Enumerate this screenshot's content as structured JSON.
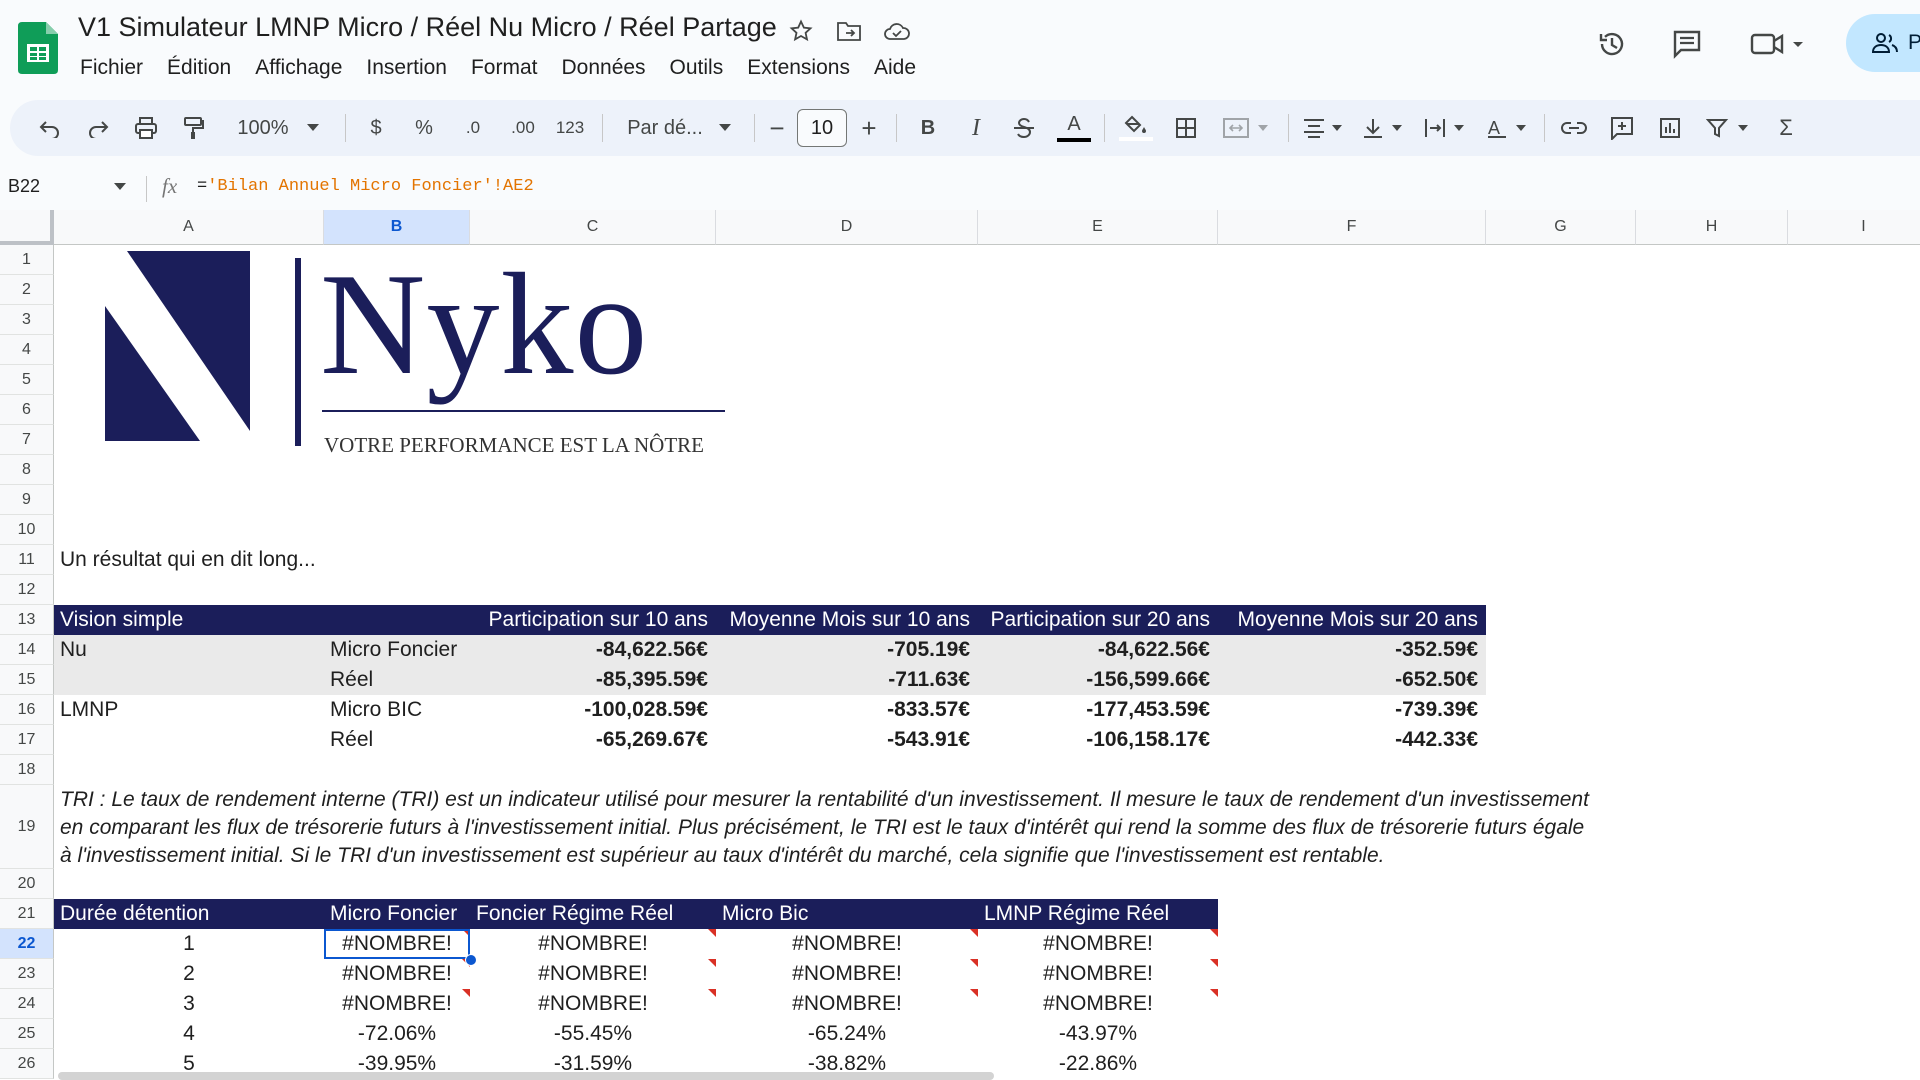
{
  "app": {
    "title": "V1 Simulateur LMNP Micro / Réel Nu Micro / Réel Partage",
    "share_label": "P"
  },
  "menu": [
    "Fichier",
    "Édition",
    "Affichage",
    "Insertion",
    "Format",
    "Données",
    "Outils",
    "Extensions",
    "Aide"
  ],
  "toolbar": {
    "zoom": "100%",
    "currency": "$",
    "percent": "%",
    "dec_decrease": ".0",
    "dec_increase": ".00",
    "number_format": "123",
    "font": "Par dé...",
    "font_size": "10",
    "minus": "−",
    "plus": "+",
    "bold": "B",
    "italic": "I",
    "text_color": "A",
    "sum": "Σ"
  },
  "formula_bar": {
    "cell_ref": "B22",
    "fx": "fx",
    "formula_prefix": "=",
    "formula_string": "'Bilan Annuel Micro Foncier'!AE2"
  },
  "columns": [
    "A",
    "B",
    "C",
    "D",
    "E",
    "F",
    "G",
    "H",
    "I"
  ],
  "rows": [
    "1",
    "2",
    "3",
    "4",
    "5",
    "6",
    "7",
    "8",
    "9",
    "10",
    "11",
    "12",
    "13",
    "14",
    "15",
    "16",
    "17",
    "18",
    "19",
    "20",
    "21",
    "22",
    "23",
    "24",
    "25",
    "26"
  ],
  "logo": {
    "brand": "Nyko",
    "tagline": "VOTRE PERFORMANCE EST LA NÔTRE"
  },
  "intro": "Un résultat qui en dit long...",
  "vision_table": {
    "headers": [
      "Vision simple",
      "Participation sur 10 ans",
      "Moyenne Mois sur 10 ans",
      "Participation sur 20 ans",
      "Moyenne Mois sur 20 ans"
    ],
    "rows": [
      {
        "group": "Nu",
        "regime": "Micro Foncier",
        "p10": "-84,622.56€",
        "m10": "-705.19€",
        "p20": "-84,622.56€",
        "m20": "-352.59€"
      },
      {
        "group": "",
        "regime": "Réel",
        "p10": "-85,395.59€",
        "m10": "-711.63€",
        "p20": "-156,599.66€",
        "m20": "-652.50€"
      },
      {
        "group": "LMNP",
        "regime": "Micro BIC",
        "p10": "-100,028.59€",
        "m10": "-833.57€",
        "p20": "-177,453.59€",
        "m20": "-739.39€"
      },
      {
        "group": "",
        "regime": "Réel",
        "p10": "-65,269.67€",
        "m10": "-543.91€",
        "p20": "-106,158.17€",
        "m20": "-442.33€"
      }
    ]
  },
  "tri_text": [
    "TRI : Le taux de rendement interne (TRI) est un indicateur utilisé pour mesurer la rentabilité d'un investissement. Il mesure le taux de rendement d'un investissement",
    "en comparant les flux de trésorerie futurs à l'investissement initial. Plus précisément, le TRI est le taux d'intérêt qui rend la somme des flux de trésorerie futurs égale",
    "à l'investissement initial. Si le TRI d'un investissement est supérieur au taux d'intérêt du marché, cela signifie que l'investissement est rentable."
  ],
  "tri_table": {
    "headers": [
      "Durée détention",
      "Micro Foncier",
      "Foncier Régime Réel",
      "Micro Bic",
      "LMNP Régime Réel"
    ],
    "rows": [
      [
        "1",
        "#NOMBRE!",
        "#NOMBRE!",
        "#NOMBRE!",
        "#NOMBRE!"
      ],
      [
        "2",
        "#NOMBRE!",
        "#NOMBRE!",
        "#NOMBRE!",
        "#NOMBRE!"
      ],
      [
        "3",
        "#NOMBRE!",
        "#NOMBRE!",
        "#NOMBRE!",
        "#NOMBRE!"
      ],
      [
        "4",
        "-72.06%",
        "-55.45%",
        "-65.24%",
        "-43.97%"
      ],
      [
        "5",
        "-39.95%",
        "-31.59%",
        "-38.82%",
        "-22.86%"
      ]
    ]
  },
  "colors": {
    "header_band": "#1b1e5a",
    "selection": "#0b57d0",
    "error_marker": "#d93025"
  }
}
